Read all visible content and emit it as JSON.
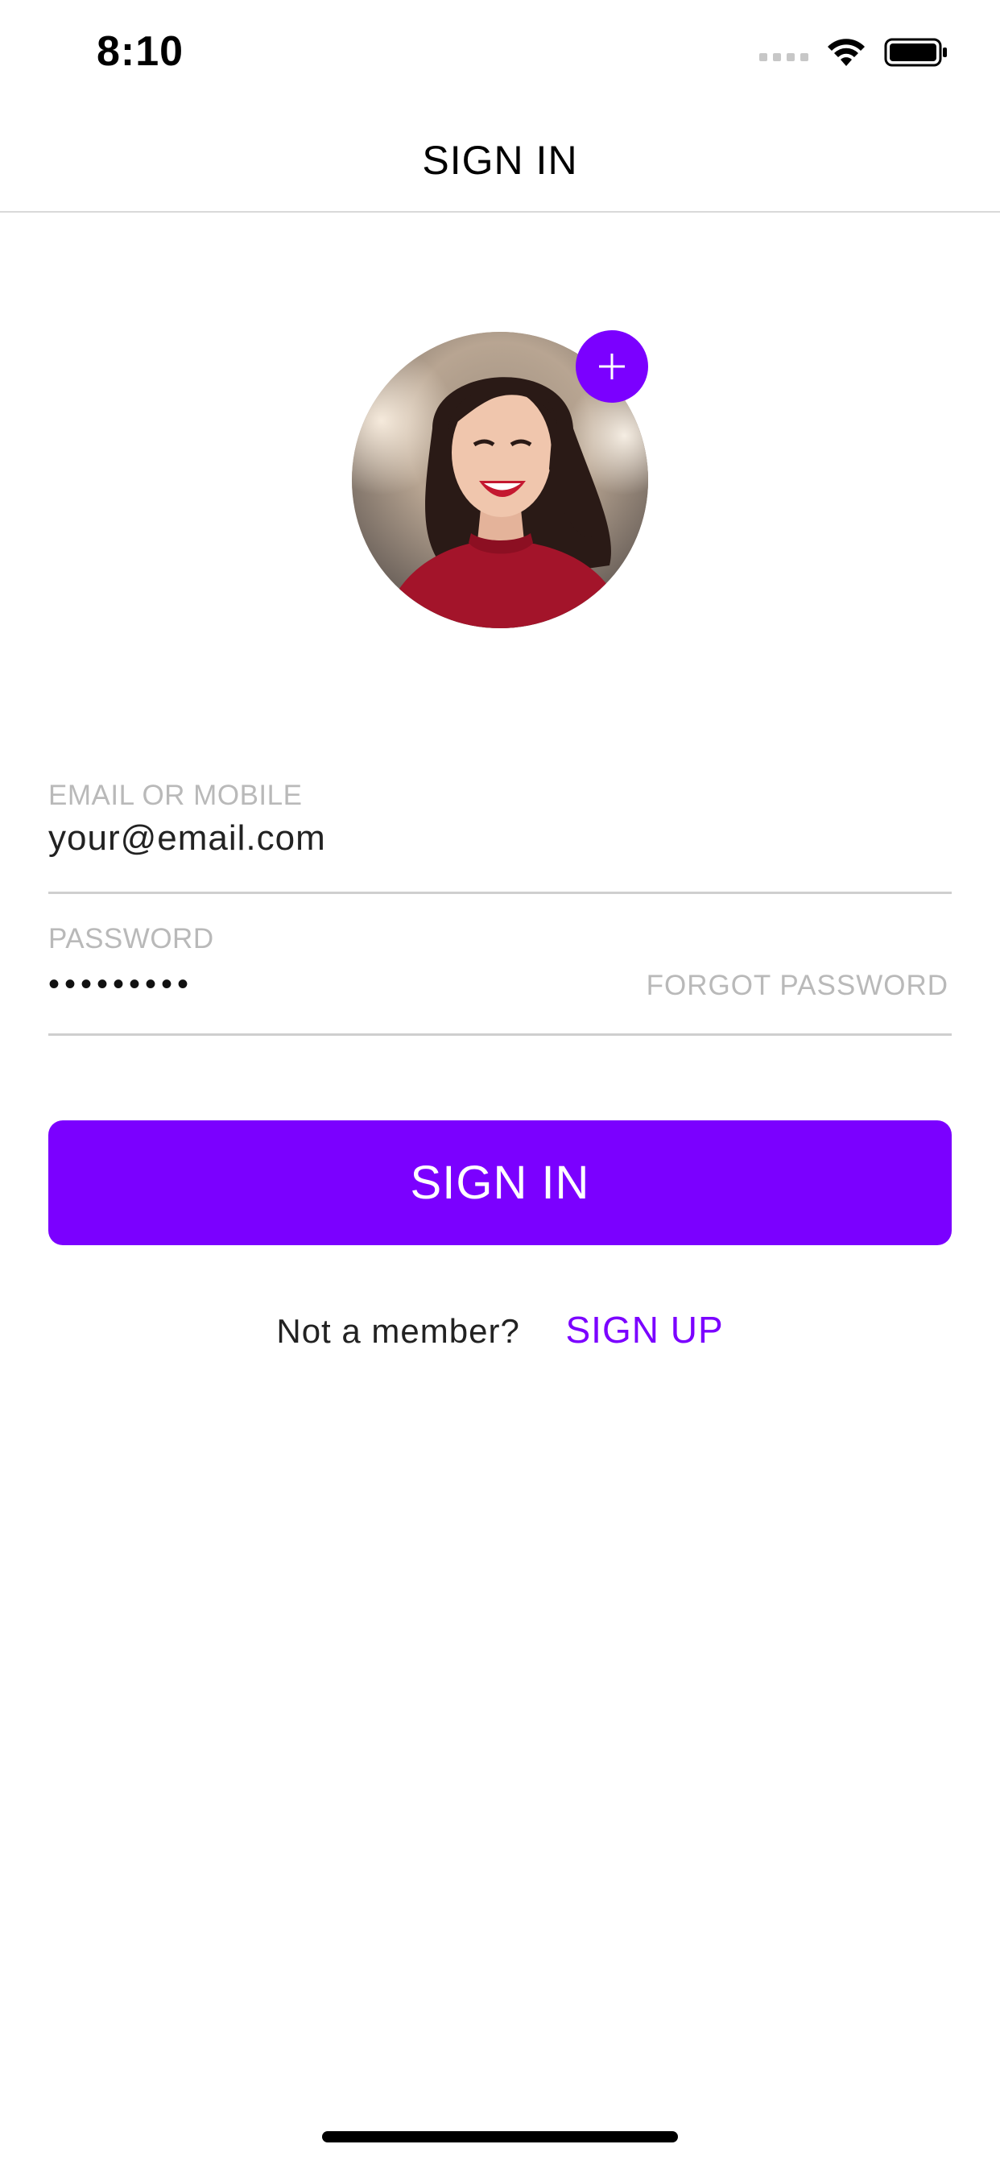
{
  "status_bar": {
    "time": "8:10"
  },
  "nav": {
    "title": "SIGN IN"
  },
  "avatar": {
    "add_photo_icon": "plus-icon"
  },
  "form": {
    "email": {
      "label": "EMAIL OR MOBILE",
      "value": "your@email.com"
    },
    "password": {
      "label": "PASSWORD",
      "masked_value": "•••••••••",
      "forgot_label": "FORGOT PASSWORD"
    }
  },
  "actions": {
    "signin_label": "SIGN IN",
    "member_prompt": "Not a member?",
    "signup_label": "SIGN UP"
  },
  "colors": {
    "accent": "#7b00ff",
    "muted_text": "#b9b9b9",
    "divider": "#cfcfcf"
  }
}
